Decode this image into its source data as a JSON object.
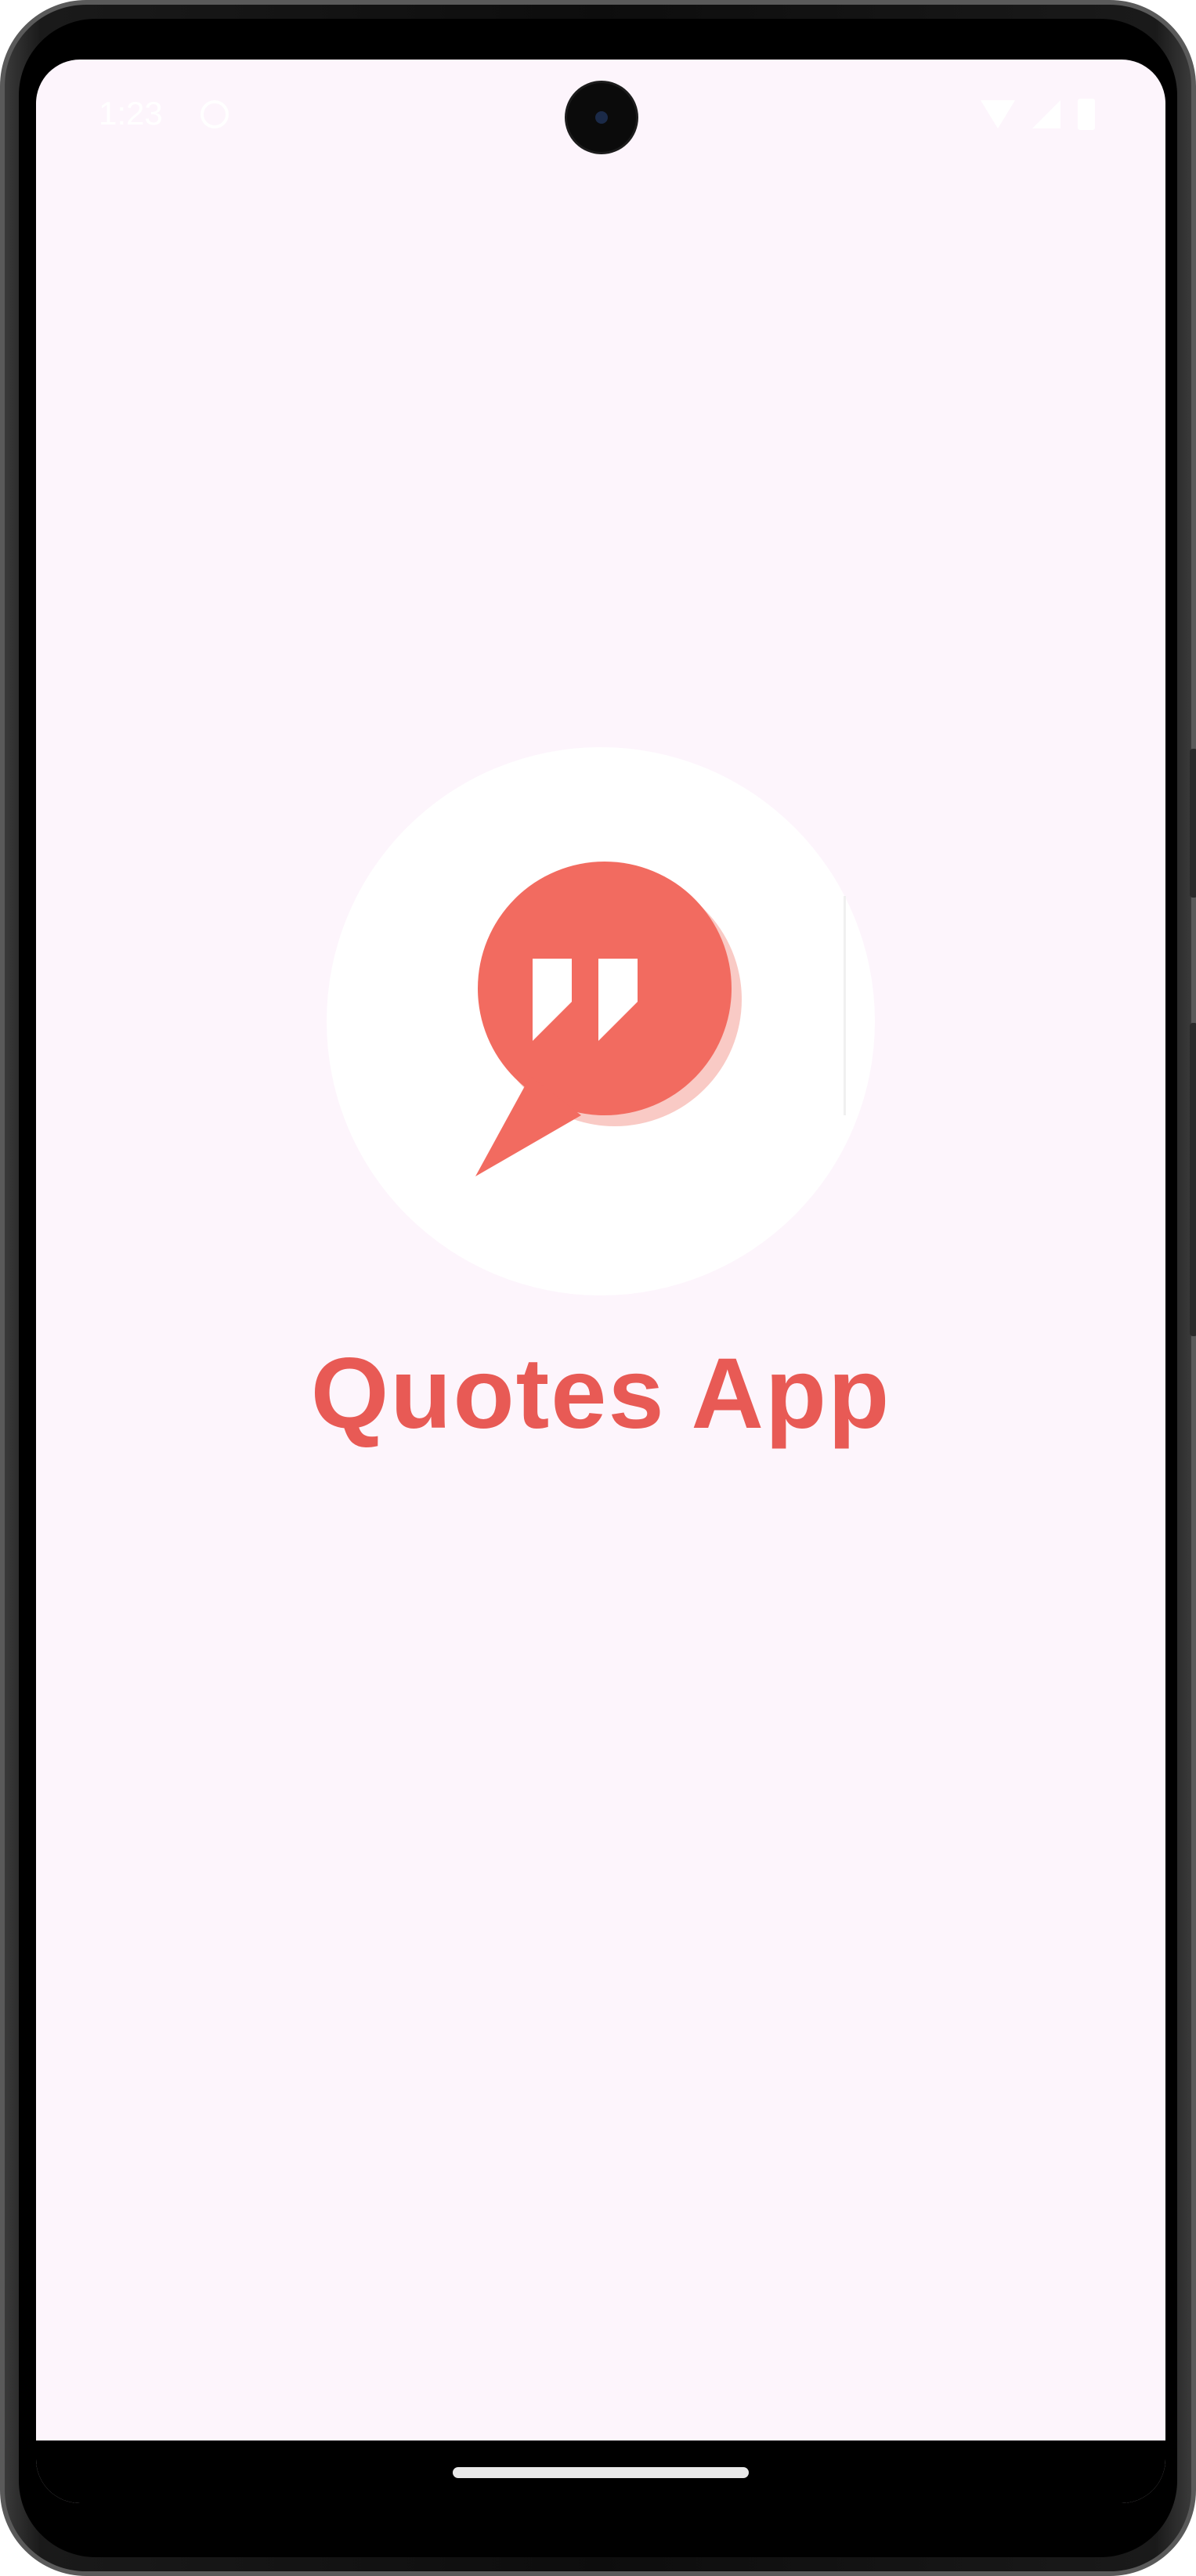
{
  "status_bar": {
    "time": "1:23",
    "left_icon": "face-icon",
    "right_icons": [
      "wifi-icon",
      "signal-icon",
      "battery-icon"
    ]
  },
  "splash": {
    "logo_icon": "quote-bubble-icon",
    "title": "Quotes App",
    "title_color": "#e85a55",
    "logo_color": "#f26b60",
    "background_color": "#fdf5fc"
  },
  "navigation": {
    "home_indicator": "home-indicator"
  }
}
